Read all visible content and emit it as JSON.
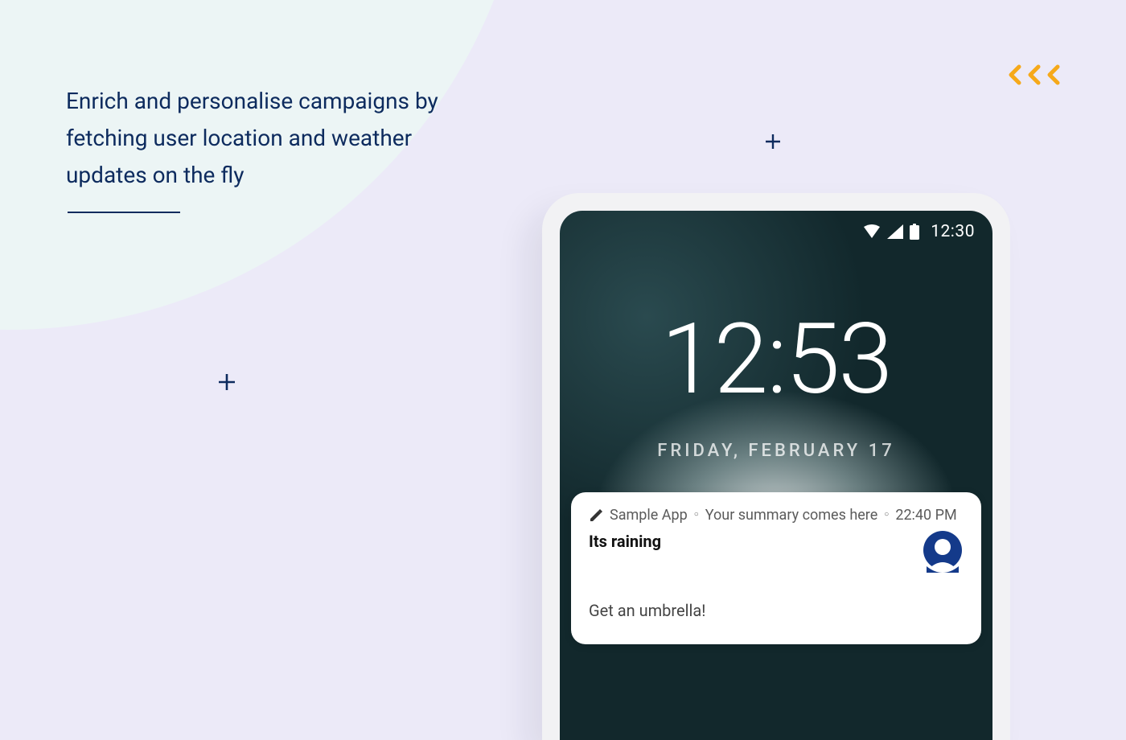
{
  "headline": "Enrich and personalise campaigns by fetching user location and weather updates on the fly",
  "statusbar": {
    "time": "12:30"
  },
  "lockscreen": {
    "clock": "12:53",
    "date": "FRIDAY, FEBRUARY 17"
  },
  "notification": {
    "app_name": "Sample App",
    "summary": "Your summary comes here",
    "time": "22:40 PM",
    "title": "Its raining",
    "body": "Get an umbrella!"
  },
  "colors": {
    "background": "#eceaf8",
    "arc": "#ecf5f5",
    "accent": "#0d2b5e",
    "chevron": "#f6a91a"
  }
}
